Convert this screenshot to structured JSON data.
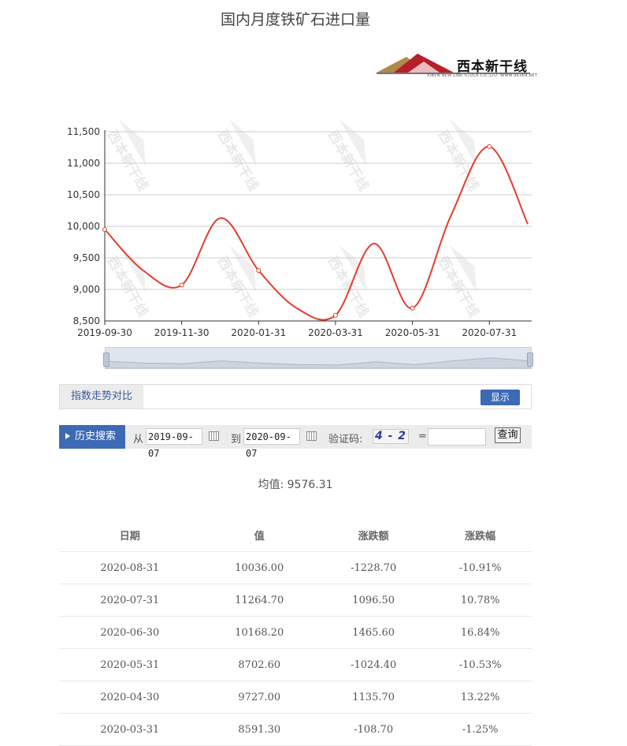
{
  "page": {
    "title": "国内月度铁矿石进口量"
  },
  "logo": {
    "name": "西本新干线",
    "subtitle": "XIBEN NEW LINE STOCK CO.,LTD.  WWW.96369.NET",
    "watermark": "西本新干线"
  },
  "colors": {
    "line": "#e23d2e",
    "accent": "#3d6ab5",
    "up": "#e21a1a",
    "down": "#1ea05a"
  },
  "chart_data": {
    "type": "line",
    "x": [
      "2019-09-30",
      "2019-10-31",
      "2019-11-30",
      "2019-12-31",
      "2020-01-31",
      "2020-02-29",
      "2020-03-31",
      "2020-04-30",
      "2020-05-31",
      "2020-06-30",
      "2020-07-31",
      "2020-08-31"
    ],
    "values": [
      9950,
      9300,
      9070,
      10130,
      9300,
      8700,
      8591.3,
      9727,
      8702.6,
      10168.2,
      11264.7,
      10036
    ],
    "xticks": [
      "2019-09-30",
      "2019-11-30",
      "2020-01-31",
      "2020-03-31",
      "2020-05-31",
      "2020-07-31"
    ],
    "yticks": [
      "8,500",
      "9,000",
      "9,500",
      "10,000",
      "10,500",
      "11,000",
      "11,500"
    ],
    "ylim": [
      8500,
      11500
    ],
    "grid": true,
    "title": "国内月度铁矿石进口量"
  },
  "compare": {
    "label": "指数走势对比",
    "button": "显示"
  },
  "search": {
    "tab": "历史搜索",
    "from_label": "从",
    "from": "2019-09-07",
    "to_label": "到",
    "to": "2020-09-07",
    "captcha_label": "验证码:",
    "captcha": "4 - 2",
    "equals": "=",
    "query": "查询"
  },
  "average": {
    "label": "均值:",
    "value": "9576.31"
  },
  "table": {
    "headers": [
      "日期",
      "值",
      "涨跌额",
      "涨跌幅"
    ],
    "rows": [
      [
        "2020-08-31",
        "10036.00",
        "-1228.70",
        "-10.91%"
      ],
      [
        "2020-07-31",
        "11264.70",
        "1096.50",
        "10.78%"
      ],
      [
        "2020-06-30",
        "10168.20",
        "1465.60",
        "16.84%"
      ],
      [
        "2020-05-31",
        "8702.60",
        "-1024.40",
        "-10.53%"
      ],
      [
        "2020-04-30",
        "9727.00",
        "1135.70",
        "13.22%"
      ],
      [
        "2020-03-31",
        "8591.30",
        "-108.70",
        "-1.25%"
      ]
    ]
  }
}
